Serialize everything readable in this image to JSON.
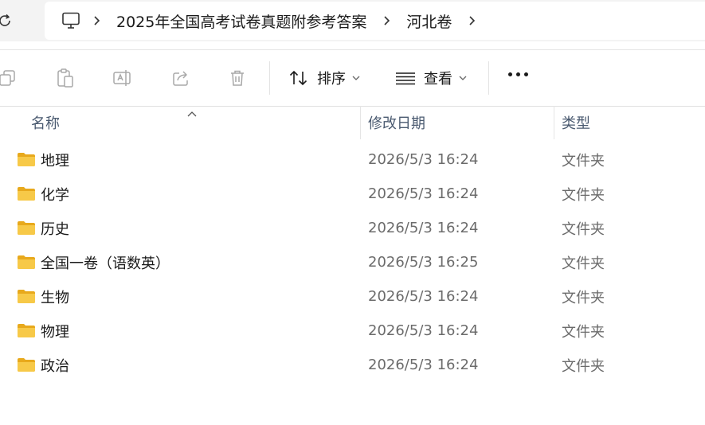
{
  "breadcrumb": {
    "items": [
      "2025年全国高考试卷真题附参考答案",
      "河北卷"
    ]
  },
  "toolbar": {
    "sort_label": "排序",
    "view_label": "查看"
  },
  "columns": {
    "name": "名称",
    "date": "修改日期",
    "type": "类型"
  },
  "files": [
    {
      "name": "地理",
      "date": "2026/5/3 16:24",
      "type": "文件夹"
    },
    {
      "name": "化学",
      "date": "2026/5/3 16:24",
      "type": "文件夹"
    },
    {
      "name": "历史",
      "date": "2026/5/3 16:24",
      "type": "文件夹"
    },
    {
      "name": "全国一卷（语数英）",
      "date": "2026/5/3 16:25",
      "type": "文件夹"
    },
    {
      "name": "生物",
      "date": "2026/5/3 16:24",
      "type": "文件夹"
    },
    {
      "name": "物理",
      "date": "2026/5/3 16:24",
      "type": "文件夹"
    },
    {
      "name": "政治",
      "date": "2026/5/3 16:24",
      "type": "文件夹"
    }
  ],
  "icons": {
    "refresh": "refresh-icon",
    "computer": "computer-icon",
    "copy": "copy-icon",
    "paste": "paste-icon",
    "rename": "rename-icon",
    "share": "share-icon",
    "delete": "delete-icon",
    "sort": "sort-icon",
    "view": "view-icon",
    "more": "more-icon",
    "folder": "folder-icon"
  },
  "colors": {
    "folder": "#f4c542",
    "header_text": "#4a5a70",
    "secondary_text": "#6b6b6b",
    "disabled_icon": "#a8a8a8"
  }
}
